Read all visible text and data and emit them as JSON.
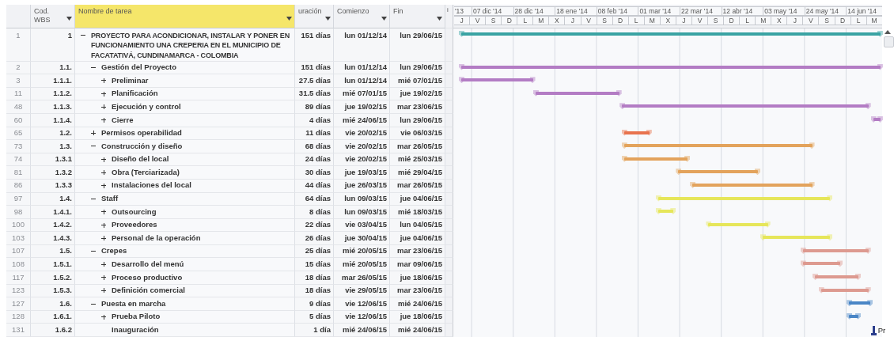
{
  "columns": [
    {
      "label": "Cod. WBS",
      "selected": false
    },
    {
      "label": "Nombre de tarea",
      "selected": true
    },
    {
      "label": "uración",
      "selected": false
    },
    {
      "label": "Comienzo",
      "selected": false
    },
    {
      "label": "Fin",
      "selected": false
    }
  ],
  "indicator_header": "i",
  "timescale": {
    "major": [
      "'13",
      "07 dic '14",
      "28 dic '14",
      "18 ene '14",
      "08 feb '14",
      "01 mar '14",
      "22 mar '14",
      "12 abr '14",
      "03 may '14",
      "24 may '14",
      "14 jun '14"
    ],
    "minor": [
      "J",
      "V",
      "S",
      "D",
      "L",
      "M",
      "X",
      "J",
      "V",
      "S",
      "D",
      "L",
      "M",
      "X",
      "J",
      "V",
      "S",
      "D",
      "L",
      "M",
      "X",
      "J",
      "V",
      "S",
      "D",
      "L",
      "M"
    ]
  },
  "tasks": [
    {
      "id": "1",
      "wbs": "1",
      "name": "PROYECTO PARA ACONDICIONAR, INSTALAR Y PONER EN FUNCIONAMIENTO UNA CREPERIA EN EL MUNICIPIO DE FACATATIVÁ, CUNDINAMARCA - COLOMBIA",
      "duration": "151 días",
      "start": "lun 01/12/14",
      "end": "lun 29/06/15",
      "kind": "summary",
      "expanded": true,
      "color": "#3aa3a3",
      "children": [
        {
          "id": "2",
          "wbs": "1.1.",
          "name": "Gestión del Proyecto",
          "duration": "151 días",
          "start": "lun 01/12/14",
          "end": "lun 29/06/15",
          "kind": "summary",
          "expanded": true,
          "color": "#b37cc4",
          "children": [
            {
              "id": "3",
              "wbs": "1.1.1.",
              "name": "Preliminar",
              "duration": "27.5 días",
              "start": "lun 01/12/14",
              "end": "mié 07/01/15",
              "kind": "summary",
              "expanded": false,
              "color": "#b37cc4"
            },
            {
              "id": "11",
              "wbs": "1.1.2.",
              "name": "Planificación",
              "duration": "31.5 días",
              "start": "mié 07/01/15",
              "end": "jue 19/02/15",
              "kind": "summary",
              "expanded": false,
              "color": "#b37cc4"
            },
            {
              "id": "48",
              "wbs": "1.1.3.",
              "name": "Ejecución y control",
              "duration": "89 días",
              "start": "jue 19/02/15",
              "end": "mar 23/06/15",
              "kind": "summary",
              "expanded": false,
              "color": "#b37cc4"
            },
            {
              "id": "60",
              "wbs": "1.1.4.",
              "name": "Cierre",
              "duration": "4 días",
              "start": "mié 24/06/15",
              "end": "lun 29/06/15",
              "kind": "summary",
              "expanded": false,
              "color": "#b37cc4"
            }
          ]
        },
        {
          "id": "65",
          "wbs": "1.2.",
          "name": "Permisos operabilidad",
          "duration": "11 días",
          "start": "vie 20/02/15",
          "end": "vie 06/03/15",
          "kind": "summary",
          "expanded": false,
          "color": "#e8734e"
        },
        {
          "id": "73",
          "wbs": "1.3.",
          "name": "Construcción y diseño",
          "duration": "68 días",
          "start": "vie 20/02/15",
          "end": "mar 26/05/15",
          "kind": "summary",
          "expanded": true,
          "color": "#e3a35c",
          "children": [
            {
              "id": "74",
              "wbs": "1.3.1",
              "name": "Diseño del local",
              "duration": "24 días",
              "start": "vie 20/02/15",
              "end": "mié 25/03/15",
              "kind": "summary",
              "expanded": false,
              "color": "#e3a35c"
            },
            {
              "id": "81",
              "wbs": "1.3.2",
              "name": "Obra (Terciarizada)",
              "duration": "30 días",
              "start": "jue 19/03/15",
              "end": "mié 29/04/15",
              "kind": "summary",
              "expanded": false,
              "color": "#e3a35c"
            },
            {
              "id": "86",
              "wbs": "1.3.3",
              "name": "Instalaciones del local",
              "duration": "44 días",
              "start": "jue 26/03/15",
              "end": "mar 26/05/15",
              "kind": "summary",
              "expanded": false,
              "color": "#e3a35c"
            }
          ]
        },
        {
          "id": "97",
          "wbs": "1.4.",
          "name": "Staff",
          "duration": "64 días",
          "start": "lun 09/03/15",
          "end": "jue 04/06/15",
          "kind": "summary",
          "expanded": true,
          "color": "#e6e65a",
          "children": [
            {
              "id": "98",
              "wbs": "1.4.1.",
              "name": "Outsourcing",
              "duration": "8 días",
              "start": "lun 09/03/15",
              "end": "mié 18/03/15",
              "kind": "summary",
              "expanded": false,
              "color": "#e6e65a"
            },
            {
              "id": "100",
              "wbs": "1.4.2.",
              "name": "Proveedores",
              "duration": "22 días",
              "start": "vie 03/04/15",
              "end": "lun 04/05/15",
              "kind": "summary",
              "expanded": false,
              "color": "#e6e65a"
            },
            {
              "id": "103",
              "wbs": "1.4.3.",
              "name": "Personal de la operación",
              "duration": "26 días",
              "start": "jue 30/04/15",
              "end": "jue 04/06/15",
              "kind": "summary",
              "expanded": false,
              "color": "#e6e65a"
            }
          ]
        },
        {
          "id": "107",
          "wbs": "1.5.",
          "name": "Crepes",
          "duration": "25 días",
          "start": "mié 20/05/15",
          "end": "mar 23/06/15",
          "kind": "summary",
          "expanded": true,
          "color": "#dd9a90",
          "children": [
            {
              "id": "108",
              "wbs": "1.5.1.",
              "name": "Desarrollo del menú",
              "duration": "15 días",
              "start": "mié 20/05/15",
              "end": "mar 09/06/15",
              "kind": "summary",
              "expanded": false,
              "color": "#dd9a90"
            },
            {
              "id": "117",
              "wbs": "1.5.2.",
              "name": "Proceso productivo",
              "duration": "18 días",
              "start": "mar 26/05/15",
              "end": "jue 18/06/15",
              "kind": "summary",
              "expanded": false,
              "color": "#dd9a90"
            },
            {
              "id": "123",
              "wbs": "1.5.3.",
              "name": "Definición comercial",
              "duration": "18 días",
              "start": "vie 29/05/15",
              "end": "mar 23/06/15",
              "kind": "summary",
              "expanded": false,
              "color": "#dd9a90"
            }
          ]
        },
        {
          "id": "127",
          "wbs": "1.6.",
          "name": "Puesta en marcha",
          "duration": "9 días",
          "start": "vie 12/06/15",
          "end": "mié 24/06/15",
          "kind": "summary",
          "expanded": true,
          "color": "#4a86c6",
          "children": [
            {
              "id": "128",
              "wbs": "1.6.1.",
              "name": "Prueba Piloto",
              "duration": "5 días",
              "start": "vie 12/06/15",
              "end": "jue 18/06/15",
              "kind": "summary",
              "expanded": false,
              "color": "#4a86c6"
            },
            {
              "id": "131",
              "wbs": "1.6.2",
              "name": "Inauguración",
              "duration": "1 día",
              "start": "mié 24/06/15",
              "end": "mié 24/06/15",
              "kind": "milestone",
              "bar_label": "Pr",
              "color": "#2a3d8c"
            }
          ]
        }
      ]
    }
  ]
}
